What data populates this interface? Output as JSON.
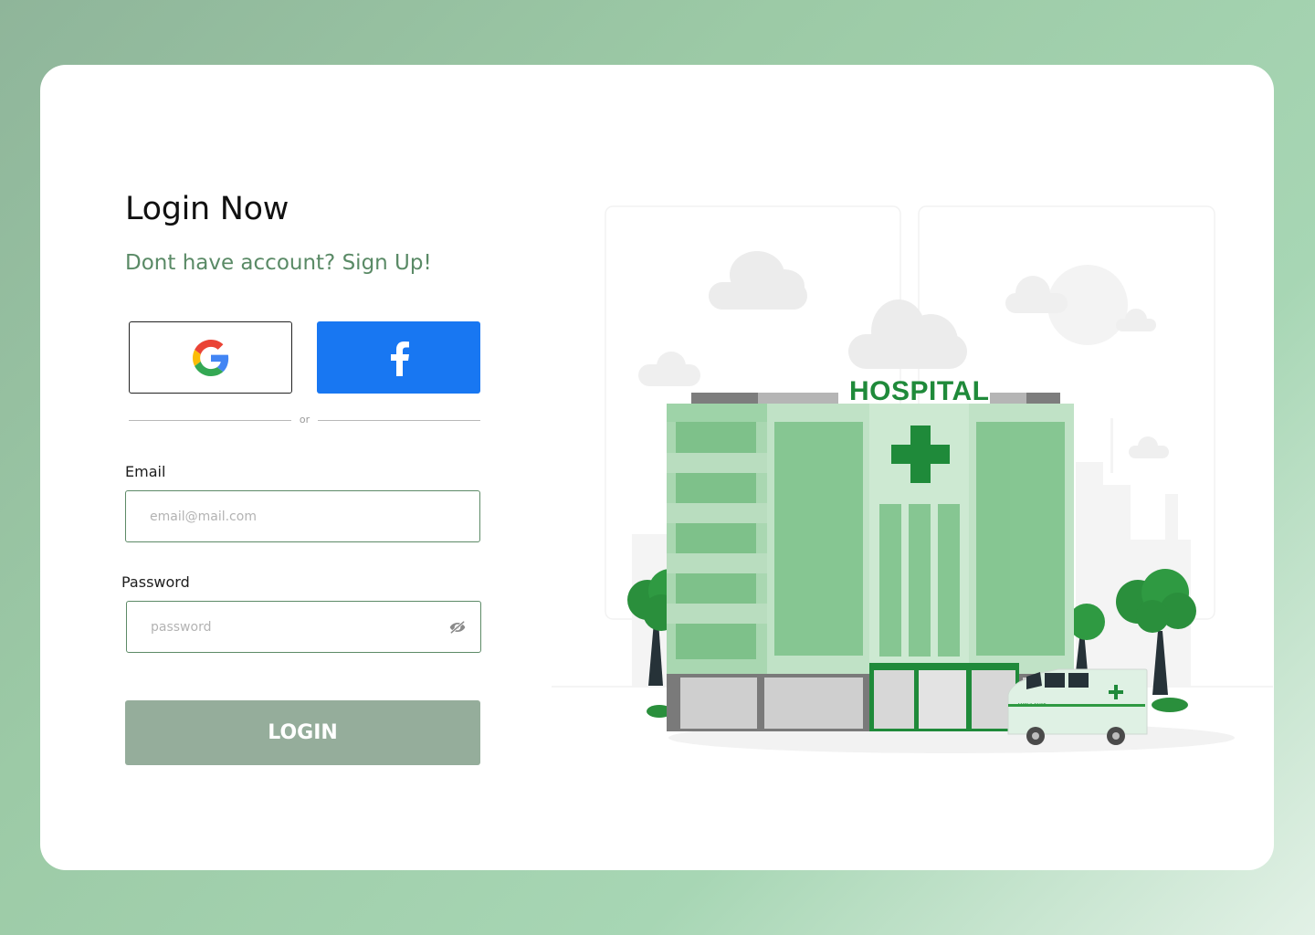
{
  "login": {
    "title": "Login Now",
    "signup_prompt": "Dont have account? Sign Up!",
    "divider_text": "or",
    "email_label": "Email",
    "email_placeholder": "email@mail.com",
    "password_label": "Password",
    "password_placeholder": "password",
    "login_button": "LOGIN"
  },
  "illustration": {
    "sign_text": "HOSPITAL",
    "ambulance_text": "AMBULANCE"
  },
  "icons": {
    "google": "google-logo-icon",
    "facebook": "facebook-logo-icon",
    "password_toggle": "eye-off-icon"
  },
  "colors": {
    "accent_green": "#5a8a66",
    "facebook_blue": "#1877f2",
    "login_button": "#95ad9b",
    "hospital_green": "#1f8a3a"
  }
}
